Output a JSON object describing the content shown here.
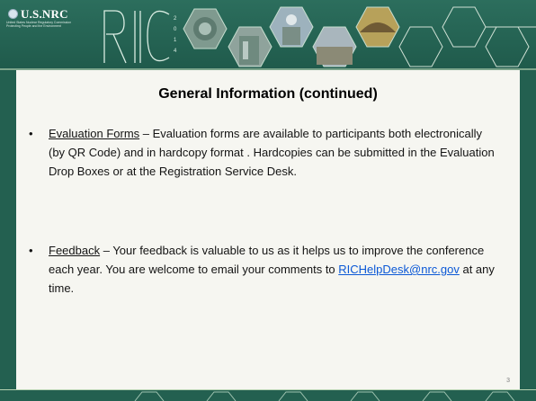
{
  "header": {
    "logo_text": "U.S.NRC",
    "logo_subtitle": "United States Nuclear Regulatory Commission\nProtecting People and the Environment",
    "event_logo_text": "RIC",
    "event_logo_year": "2014",
    "colors": {
      "background": "#236050",
      "accent_line": "#b6d3b2"
    }
  },
  "slide": {
    "title": "General Information (continued)",
    "page_number": "3",
    "bullets": [
      {
        "term": "Evaluation Forms",
        "text": " – Evaluation forms are available to participants both electronically (by QR Code) and in hardcopy format .  Hardcopies can be submitted in the Evaluation Drop Boxes or at the Registration Service Desk."
      },
      {
        "term": "Feedback",
        "text_before_link": " – Your feedback is valuable to us as it helps us to improve the conference each year.  You are welcome to email your comments to ",
        "link": "RICHelpDesk@nrc.gov",
        "text_after_link": " at any time."
      }
    ]
  }
}
